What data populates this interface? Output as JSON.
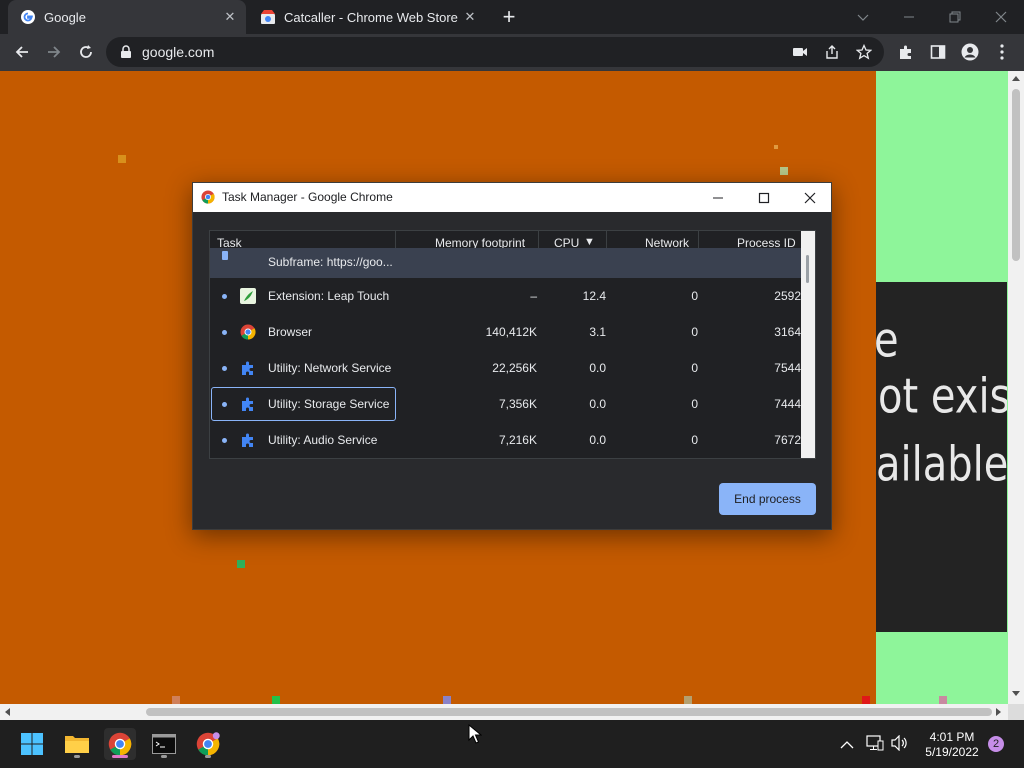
{
  "browser": {
    "tabs": [
      {
        "title": "Google",
        "active": true
      },
      {
        "title": "Catcaller - Chrome Web Store",
        "active": false
      }
    ],
    "new_tab_symbol": "+",
    "address": "google.com"
  },
  "page": {
    "error_text_lines": [
      "e",
      "ot exist",
      "ailable."
    ]
  },
  "task_manager": {
    "title": "Task Manager - Google Chrome",
    "columns": {
      "task": "Task",
      "memory": "Memory footprint",
      "cpu": "CPU",
      "network": "Network",
      "pid": "Process ID"
    },
    "sort_indicator": "▼",
    "rows": [
      {
        "name": "Subframe: https://goo...",
        "memory": "",
        "cpu": "",
        "network": "",
        "pid": ""
      },
      {
        "name": "Extension: Leap Touch",
        "memory": "–",
        "cpu": "12.4",
        "network": "0",
        "pid": "2592"
      },
      {
        "name": "Browser",
        "memory": "140,412K",
        "cpu": "3.1",
        "network": "0",
        "pid": "3164"
      },
      {
        "name": "Utility: Network Service",
        "memory": "22,256K",
        "cpu": "0.0",
        "network": "0",
        "pid": "7544"
      },
      {
        "name": "Utility: Storage Service",
        "memory": "7,356K",
        "cpu": "0.0",
        "network": "0",
        "pid": "7444"
      },
      {
        "name": "Utility: Audio Service",
        "memory": "7,216K",
        "cpu": "0.0",
        "network": "0",
        "pid": "7672"
      }
    ],
    "end_process_label": "End process"
  },
  "taskbar": {
    "time": "4:01 PM",
    "date": "5/19/2022",
    "notification_count": "2"
  },
  "colors": {
    "page_orange": "#c45a00",
    "page_green": "#8ef59a",
    "accent_blue": "#8ab4f8"
  }
}
